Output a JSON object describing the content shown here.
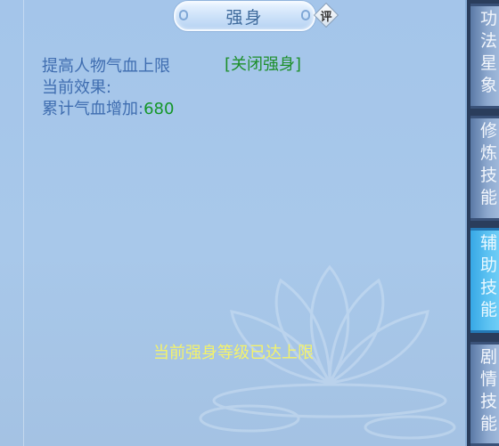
{
  "header": {
    "title": "强身",
    "rate_label": "评"
  },
  "content": {
    "line1": "提高人物气血上限",
    "toggle_link": "[关闭强身]",
    "line2": "当前效果:",
    "line3_label": "累计气血增加:",
    "line3_value": "680",
    "max_notice": "当前强身等级已达上限"
  },
  "tabs": [
    {
      "chars": [
        "功",
        "法",
        "星",
        "象"
      ],
      "active": false
    },
    {
      "chars": [
        "修",
        "炼",
        "技",
        "能"
      ],
      "active": false
    },
    {
      "chars": [
        "辅",
        "助",
        "技",
        "能"
      ],
      "active": true
    },
    {
      "chars": [
        "剧",
        "情",
        "技",
        "能"
      ],
      "active": false
    }
  ],
  "colors": {
    "panel_bg": "#a8c8ea",
    "text_blue": "#3f6db0",
    "link_green": "#1d8f2a",
    "notice_yellow": "#f4f26a",
    "active_tab": "#37a8e6"
  }
}
